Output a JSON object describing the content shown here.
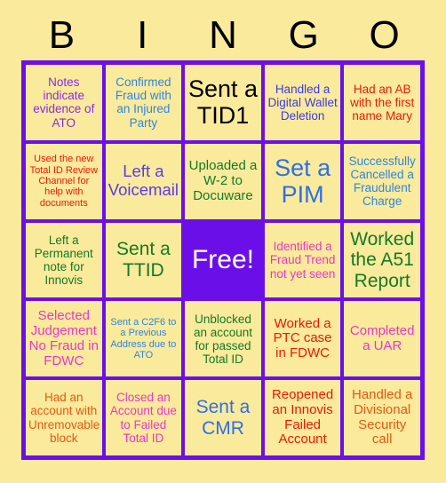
{
  "card": {
    "background_color": "#FAEA9B",
    "grid_line_color": "#6B0FE8",
    "header": {
      "letters": [
        "B",
        "I",
        "N",
        "G",
        "O"
      ],
      "color": "#000000"
    },
    "rows": [
      [
        {
          "text": "Notes indicate evidence of ATO",
          "color": "#8A2BE2",
          "size": "s"
        },
        {
          "text": "Confirmed Fraud with an Injured Party",
          "color": "#2E86DE",
          "size": "s"
        },
        {
          "text": "Sent a TID1",
          "color": "#000000",
          "size": "xl"
        },
        {
          "text": "Handled a Digital Wallet Deletion",
          "color": "#3B3BE8",
          "size": "s"
        },
        {
          "text": "Had an AB with the first name Mary",
          "color": "#E8190C",
          "size": "s"
        }
      ],
      [
        {
          "text": "Used the new Total ID Review Channel for help with documents",
          "color": "#E8190C",
          "size": "xs"
        },
        {
          "text": "Left a Voicemail",
          "color": "#5B3BE8",
          "size": "l"
        },
        {
          "text": "Uploaded a W-2 to Docuware",
          "color": "#137A26",
          "size": "m"
        },
        {
          "text": "Set a PIM",
          "color": "#2E6FE8",
          "size": "xl"
        },
        {
          "text": "Successfully Cancelled a Fraudulent Charge",
          "color": "#2E86DE",
          "size": "s"
        }
      ],
      [
        {
          "text": "Left a Permanent note for Innovis",
          "color": "#137A26",
          "size": "s"
        },
        {
          "text": "Sent a TTID",
          "color": "#137A26",
          "size": "l"
        },
        {
          "text": "Free!",
          "color": "#FFFFFF",
          "size": "free",
          "is_free": true
        },
        {
          "text": "Identified a Fraud Trend not yet seen",
          "color": "#E838C8",
          "size": "s"
        },
        {
          "text": "Worked the A51 Report",
          "color": "#137A26",
          "size": "l"
        }
      ],
      [
        {
          "text": "Selected Judgement No Fraud in FDWC",
          "color": "#E838C8",
          "size": "m"
        },
        {
          "text": "Sent a C2F6 to a Previous Address due to ATO",
          "color": "#2E86DE",
          "size": "xs"
        },
        {
          "text": "Unblocked an account for passed Total ID",
          "color": "#137A26",
          "size": "s"
        },
        {
          "text": "Worked a PTC case in FDWC",
          "color": "#E8190C",
          "size": "m"
        },
        {
          "text": "Completed a UAR",
          "color": "#E838C8",
          "size": "m"
        }
      ],
      [
        {
          "text": "Had an account with Unremovable block",
          "color": "#E05A16",
          "size": "s"
        },
        {
          "text": "Closed an Account due to Failed Total ID",
          "color": "#E838C8",
          "size": "s"
        },
        {
          "text": "Sent a CMR",
          "color": "#2E6FE8",
          "size": "l"
        },
        {
          "text": "Reopened an Innovis Failed Account",
          "color": "#E8190C",
          "size": "m"
        },
        {
          "text": "Handled a Divisional Security call",
          "color": "#E05A16",
          "size": "m"
        }
      ]
    ]
  }
}
